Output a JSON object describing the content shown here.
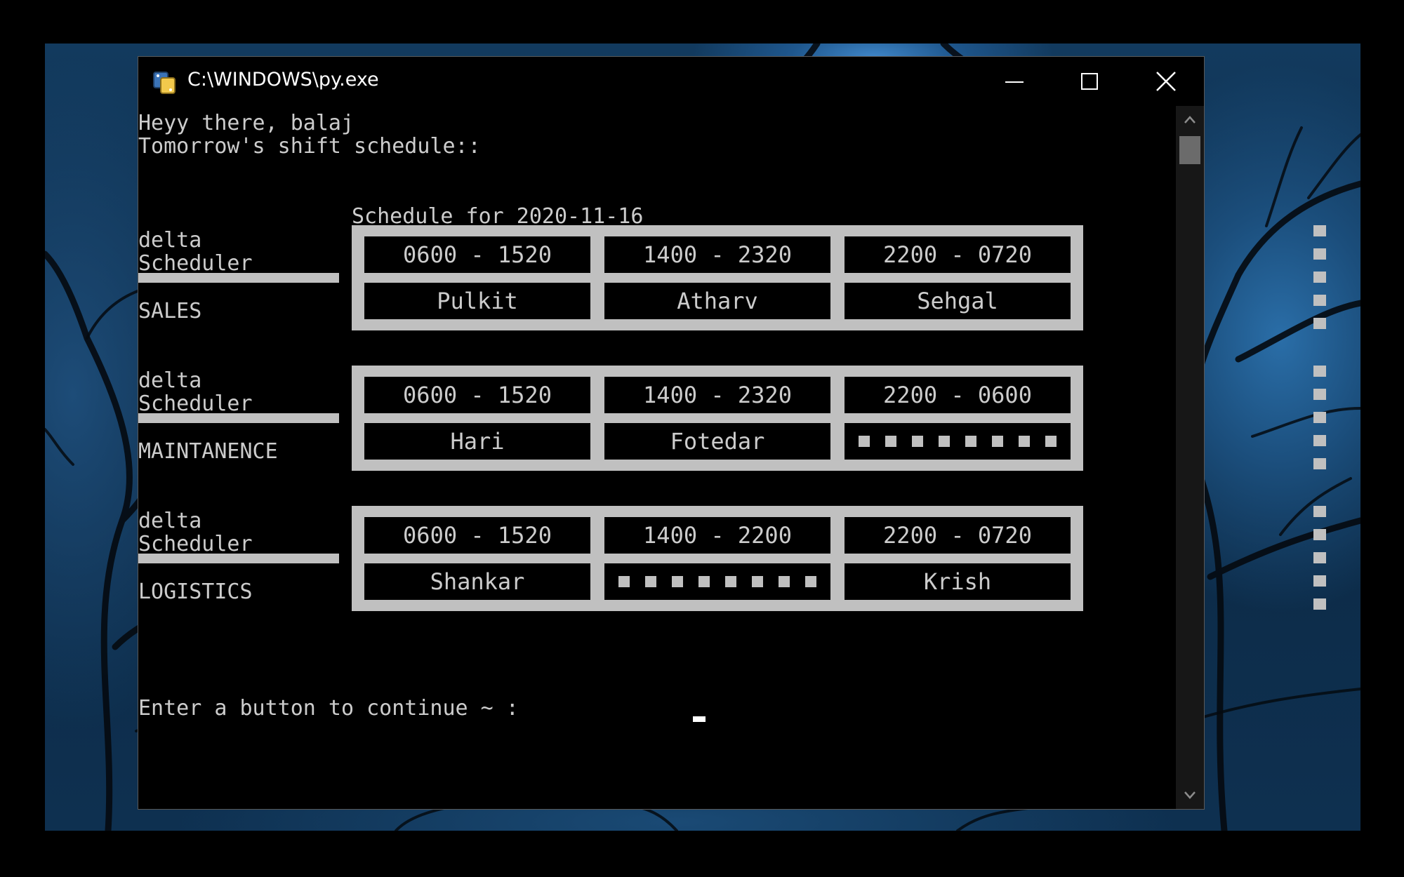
{
  "window": {
    "title": "C:\\WINDOWS\\py.exe",
    "controls": [
      "minimize-icon",
      "maximize-icon",
      "close-icon"
    ]
  },
  "console": {
    "greeting": "Heyy there, balaj",
    "subtitle": "Tomorrow's shift schedule::",
    "schedule_title": "Schedule for 2020-11-16",
    "prompt": "Enter a button to continue ~ :"
  },
  "departments": [
    {
      "line1": "delta",
      "line2": "Scheduler",
      "name": "SALES",
      "shifts": [
        "0600 - 1520",
        "1400 - 2320",
        "2200 - 0720"
      ],
      "staff": [
        "Pulkit",
        "Atharv",
        "Sehgal"
      ]
    },
    {
      "line1": "delta",
      "line2": "Scheduler",
      "name": "MAINTANENCE",
      "shifts": [
        "0600 - 1520",
        "1400 - 2320",
        "2200 - 0600"
      ],
      "staff": [
        "Hari",
        "Fotedar",
        ""
      ]
    },
    {
      "line1": "delta",
      "line2": "Scheduler",
      "name": "LOGISTICS",
      "shifts": [
        "0600 - 1520",
        "1400 - 2200",
        "2200 - 0720"
      ],
      "staff": [
        "Shankar",
        "",
        "Krish"
      ]
    }
  ],
  "colors": {
    "console_bg": "#000000",
    "console_text": "#cccccc",
    "table_frame": "#c0c0c0"
  }
}
